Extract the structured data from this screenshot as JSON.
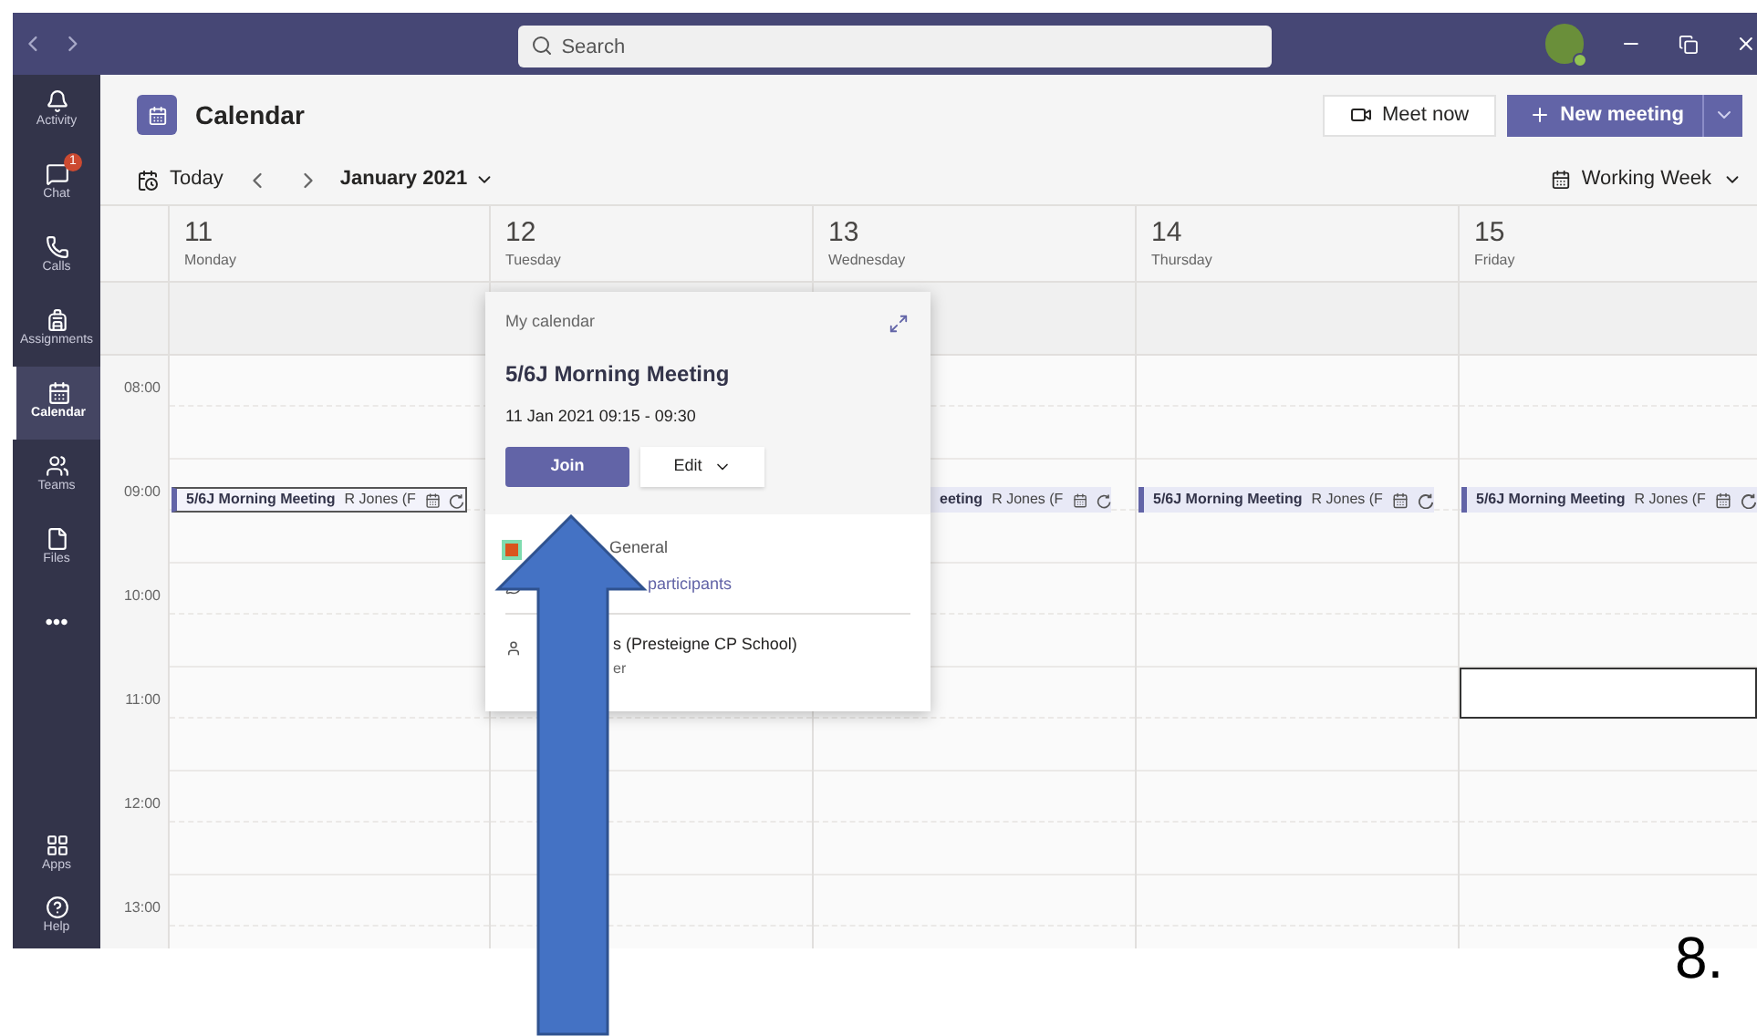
{
  "title_bar": {
    "search": {
      "placeholder": "Search"
    }
  },
  "sidebar": {
    "items": [
      {
        "label": "Activity",
        "selected": false
      },
      {
        "label": "Chat",
        "selected": false,
        "badge": "1"
      },
      {
        "label": "Calls",
        "selected": false
      },
      {
        "label": "Assignments",
        "selected": false
      },
      {
        "label": "Calendar",
        "selected": true
      },
      {
        "label": "Teams",
        "selected": false
      },
      {
        "label": "Files",
        "selected": false
      },
      {
        "label": "•••",
        "selected": false
      }
    ],
    "bottom_items": [
      {
        "label": "Apps"
      },
      {
        "label": "Help"
      }
    ]
  },
  "header": {
    "title": "Calendar",
    "meet_now": "Meet now",
    "new_meeting": "New meeting"
  },
  "toolbar": {
    "today": "Today",
    "month": "January 2021",
    "view": "Working Week"
  },
  "days": [
    {
      "date": "11",
      "weekday": "Monday",
      "slot_selected": false,
      "event": {
        "kind": "full",
        "title": "5/6J Morning Meeting",
        "organizer": "R Jones (F",
        "selected": true
      }
    },
    {
      "date": "12",
      "weekday": "Tuesday",
      "slot_selected": false
    },
    {
      "date": "13",
      "weekday": "Wednesday",
      "slot_selected": false,
      "event": {
        "kind": "covered",
        "title": "eeting",
        "organizer": "R Jones (F",
        "selected": false
      }
    },
    {
      "date": "14",
      "weekday": "Thursday",
      "slot_selected": false,
      "event": {
        "kind": "full",
        "title": "5/6J Morning Meeting",
        "organizer": "R Jones (F",
        "selected": false
      }
    },
    {
      "date": "15",
      "weekday": "Friday",
      "slot_selected": true,
      "event": {
        "kind": "full",
        "title": "5/6J Morning Meeting",
        "organizer": "R Jones (F",
        "selected": false
      }
    }
  ],
  "hours": [
    "08:00",
    "09:00",
    "10:00",
    "11:00",
    "12:00",
    "13:00"
  ],
  "popup": {
    "calendar": "My calendar",
    "title": "5/6J Morning Meeting",
    "time": "11 Jan 2021 09:15 - 09:30",
    "join": "Join",
    "edit": "Edit",
    "channel": "General",
    "chat_link": "participants",
    "organizer": "s (Presteigne CP School)",
    "organizer_role": "er"
  },
  "annotation": {
    "step": "8."
  }
}
